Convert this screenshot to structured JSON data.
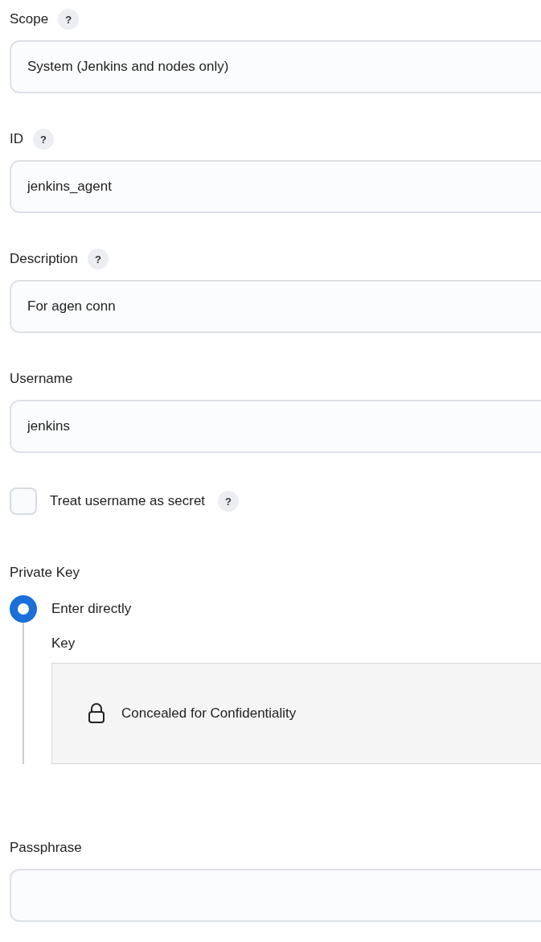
{
  "fields": [
    {
      "kind": "text",
      "label": "Scope",
      "help": "?",
      "value": "System (Jenkins and nodes only)"
    },
    {
      "kind": "text",
      "label": "ID",
      "help": "?",
      "value": "jenkins_agent"
    },
    {
      "kind": "text",
      "label": "Description",
      "help": "?",
      "value": "For agen conn"
    },
    {
      "kind": "text",
      "label": "Username",
      "value": "jenkins"
    },
    {
      "kind": "checkbox",
      "label": "Treat username as secret",
      "help": "?",
      "checked": false
    },
    {
      "kind": "radio_group",
      "label": "Private Key",
      "options": [
        {
          "label": "Enter directly",
          "selected": true,
          "key_label": "Key",
          "key_text": "Concealed for Confidentiality"
        }
      ]
    },
    {
      "kind": "text",
      "label": "Passphrase"
    }
  ]
}
